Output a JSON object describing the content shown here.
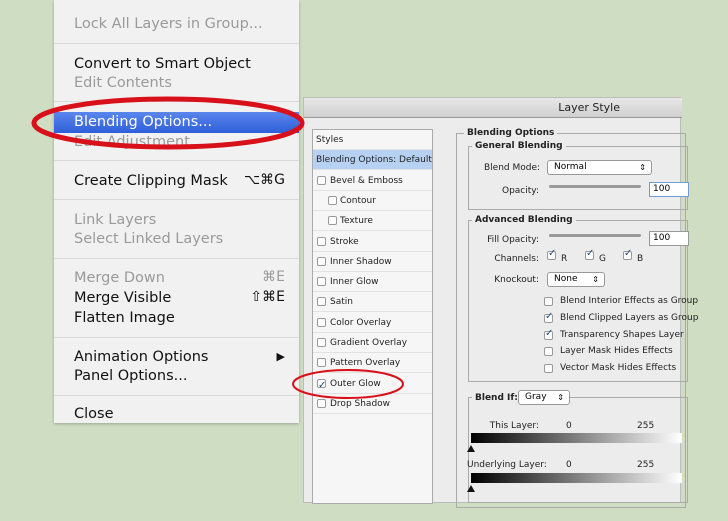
{
  "menu": {
    "items": [
      {
        "label": "Lock All Layers in Group...",
        "disabled": true
      },
      {
        "label": "Convert to Smart Object",
        "disabled": false
      },
      {
        "label": "Edit Contents",
        "disabled": true
      },
      {
        "label": "Blending Options...",
        "highlighted": true
      },
      {
        "label": "Edit Adjustment...",
        "disabled": true
      },
      {
        "label": "Create Clipping Mask",
        "shortcut": "⌥⌘G"
      },
      {
        "label": "Link Layers",
        "disabled": true
      },
      {
        "label": "Select Linked Layers",
        "disabled": true
      },
      {
        "label": "Merge Down",
        "shortcut": "⌘E",
        "disabled": true
      },
      {
        "label": "Merge Visible",
        "shortcut": "⇧⌘E"
      },
      {
        "label": "Flatten Image"
      },
      {
        "label": "Animation Options",
        "submenu": "▶"
      },
      {
        "label": "Panel Options..."
      },
      {
        "label": "Close"
      }
    ]
  },
  "dialog": {
    "title": "Layer Style",
    "styles": [
      {
        "label": "Styles"
      },
      {
        "label": "Blending Options: Default",
        "selected": true
      },
      {
        "label": "Bevel & Emboss",
        "checked": false
      },
      {
        "label": "Contour",
        "checked": false
      },
      {
        "label": "Texture",
        "checked": false
      },
      {
        "label": "Stroke",
        "checked": false
      },
      {
        "label": "Inner Shadow",
        "checked": false
      },
      {
        "label": "Inner Glow",
        "checked": false
      },
      {
        "label": "Satin",
        "checked": false
      },
      {
        "label": "Color Overlay",
        "checked": false
      },
      {
        "label": "Gradient Overlay",
        "checked": false
      },
      {
        "label": "Pattern Overlay",
        "checked": false
      },
      {
        "label": "Outer Glow",
        "checked": true
      },
      {
        "label": "Drop Shadow",
        "checked": false
      }
    ],
    "blending_options": "Blending Options",
    "general": {
      "title": "General Blending",
      "blend_mode_label": "Blend Mode:",
      "blend_mode": "Normal",
      "opacity_label": "Opacity:",
      "opacity": "100"
    },
    "advanced": {
      "title": "Advanced Blending",
      "fill_label": "Fill Opacity:",
      "fill": "100",
      "channels_label": "Channels:",
      "channels": [
        {
          "label": "R",
          "checked": true
        },
        {
          "label": "G",
          "checked": true
        },
        {
          "label": "B",
          "checked": true
        }
      ],
      "knockout_label": "Knockout:",
      "knockout": "None",
      "options": [
        {
          "label": "Blend Interior Effects as Group",
          "checked": false
        },
        {
          "label": "Blend Clipped Layers as Group",
          "checked": true
        },
        {
          "label": "Transparency Shapes Layer",
          "checked": true
        },
        {
          "label": "Layer Mask Hides Effects",
          "checked": false
        },
        {
          "label": "Vector Mask Hides Effects",
          "checked": false
        }
      ]
    },
    "blend_if": {
      "label": "Blend If:",
      "value": "Gray",
      "this_layer": "This Layer:",
      "underlying": "Underlying Layer:",
      "min": "0",
      "max": "255"
    }
  },
  "colors": {
    "highlight": "#3566dd",
    "annotation": "#d8101a",
    "background": "#cfdec3"
  }
}
